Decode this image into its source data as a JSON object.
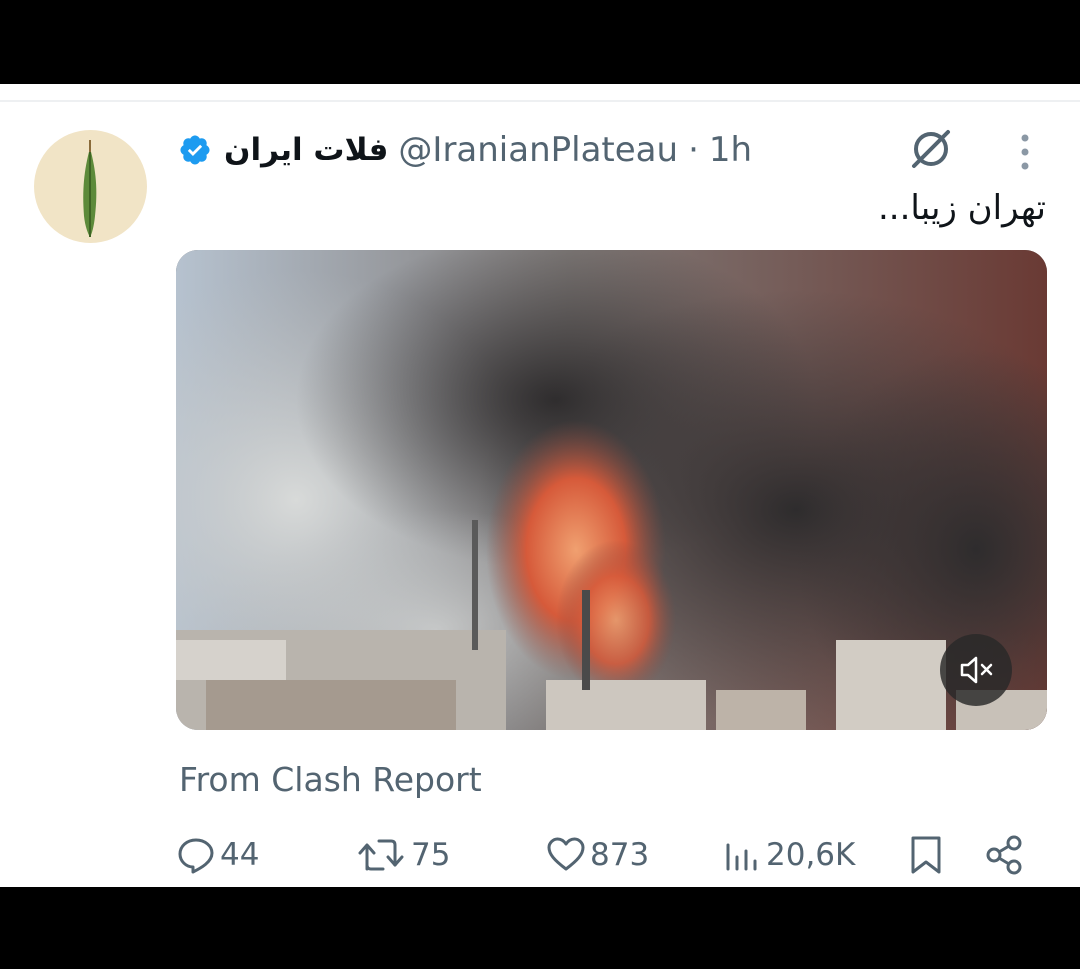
{
  "tweet": {
    "author": {
      "display_name": "فلات ایران",
      "handle": "@IranianPlateau",
      "verified": true,
      "avatar_icon": "cypress-tree-icon"
    },
    "separator": "·",
    "time": "1h",
    "text": "تهران زیبا...",
    "media": {
      "type": "video",
      "muted": true,
      "mute_icon": "speaker-muted-icon"
    },
    "source_label": "From Clash Report",
    "metrics": {
      "replies": "44",
      "reposts": "75",
      "likes": "873",
      "views": "20,6K"
    },
    "icons": {
      "grok": "grok-icon",
      "more": "more-vertical-icon",
      "reply": "reply-icon",
      "repost": "repost-icon",
      "like": "heart-icon",
      "views": "views-chart-icon",
      "bookmark": "bookmark-icon",
      "share": "share-icon"
    }
  },
  "colors": {
    "text_primary": "#0f1419",
    "text_secondary": "#536471",
    "verified_blue": "#1d9bf0",
    "avatar_bg": "#f1e4c6"
  }
}
